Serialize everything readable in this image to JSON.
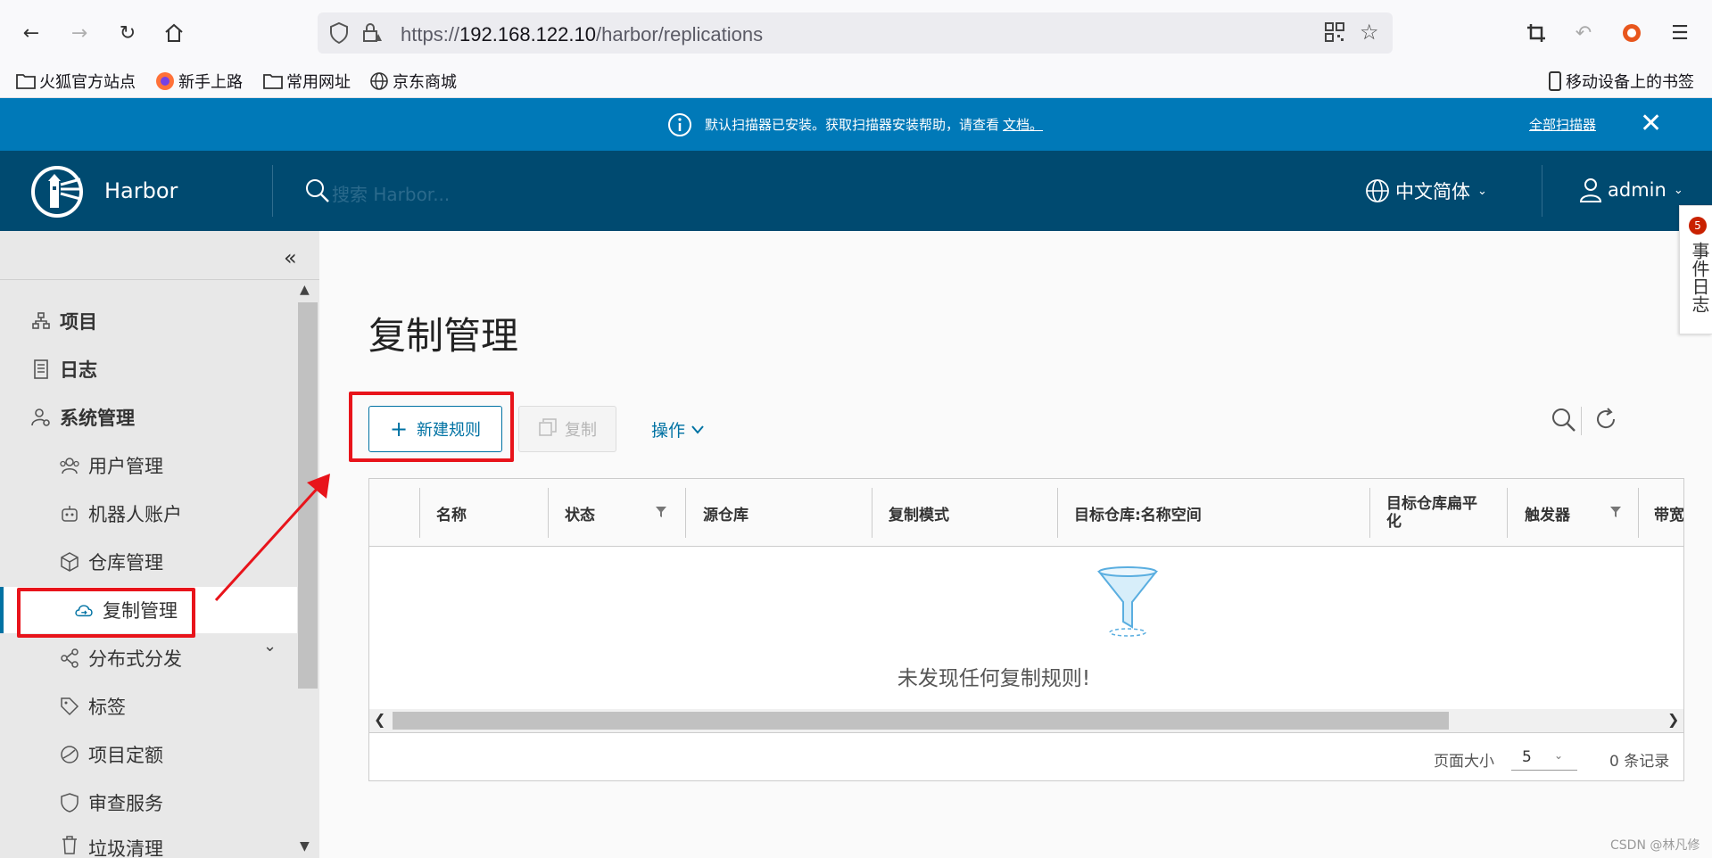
{
  "browser": {
    "url_prefix": "https://",
    "url_host": "192.168.122.10",
    "url_path": "/harbor/replications",
    "bookmarks": [
      "火狐官方站点",
      "新手上路",
      "常用网址",
      "京东商城"
    ],
    "mobile_bookmarks": "移动设备上的书签"
  },
  "banner": {
    "message": "默认扫描器已安装。获取扫描器安装帮助，请查看",
    "doc_link": "文档。",
    "all_scanners": "全部扫描器",
    "close": "✕"
  },
  "header": {
    "brand": "Harbor",
    "search_placeholder": "搜索 Harbor...",
    "language": "中文简体",
    "user": "admin"
  },
  "sidebar": {
    "items": [
      {
        "label": "项目",
        "icon": "projects-icon"
      },
      {
        "label": "日志",
        "icon": "logs-icon"
      },
      {
        "label": "系统管理",
        "icon": "admin-icon"
      },
      {
        "label": "用户管理",
        "icon": "users-icon"
      },
      {
        "label": "机器人账户",
        "icon": "robot-icon"
      },
      {
        "label": "仓库管理",
        "icon": "registry-icon"
      },
      {
        "label": "复制管理",
        "icon": "replication-icon"
      },
      {
        "label": "分布式分发",
        "icon": "distribution-icon"
      },
      {
        "label": "标签",
        "icon": "tag-icon"
      },
      {
        "label": "项目定额",
        "icon": "quota-icon"
      },
      {
        "label": "审查服务",
        "icon": "shield-icon"
      },
      {
        "label": "垃圾清理",
        "icon": "trash-icon"
      }
    ],
    "active": "复制管理"
  },
  "main": {
    "title": "复制管理",
    "new_rule": "新建规则",
    "copy": "复制",
    "actions": "操作",
    "columns": [
      "名称",
      "状态",
      "源仓库",
      "复制模式",
      "目标仓库:名称空间",
      "目标仓库扁平化",
      "触发器",
      "带宽"
    ],
    "empty_text": "未发现任何复制规则!",
    "page_size_label": "页面大小",
    "page_size": "5",
    "record_count": "0 条记录"
  },
  "event_log": {
    "label": "事件日志",
    "count": "5"
  },
  "watermark": "CSDN @林凡修",
  "colors": {
    "banner": "#0079b8",
    "header": "#004a70",
    "accent": "#0072a3",
    "annotation": "#e8141b"
  }
}
